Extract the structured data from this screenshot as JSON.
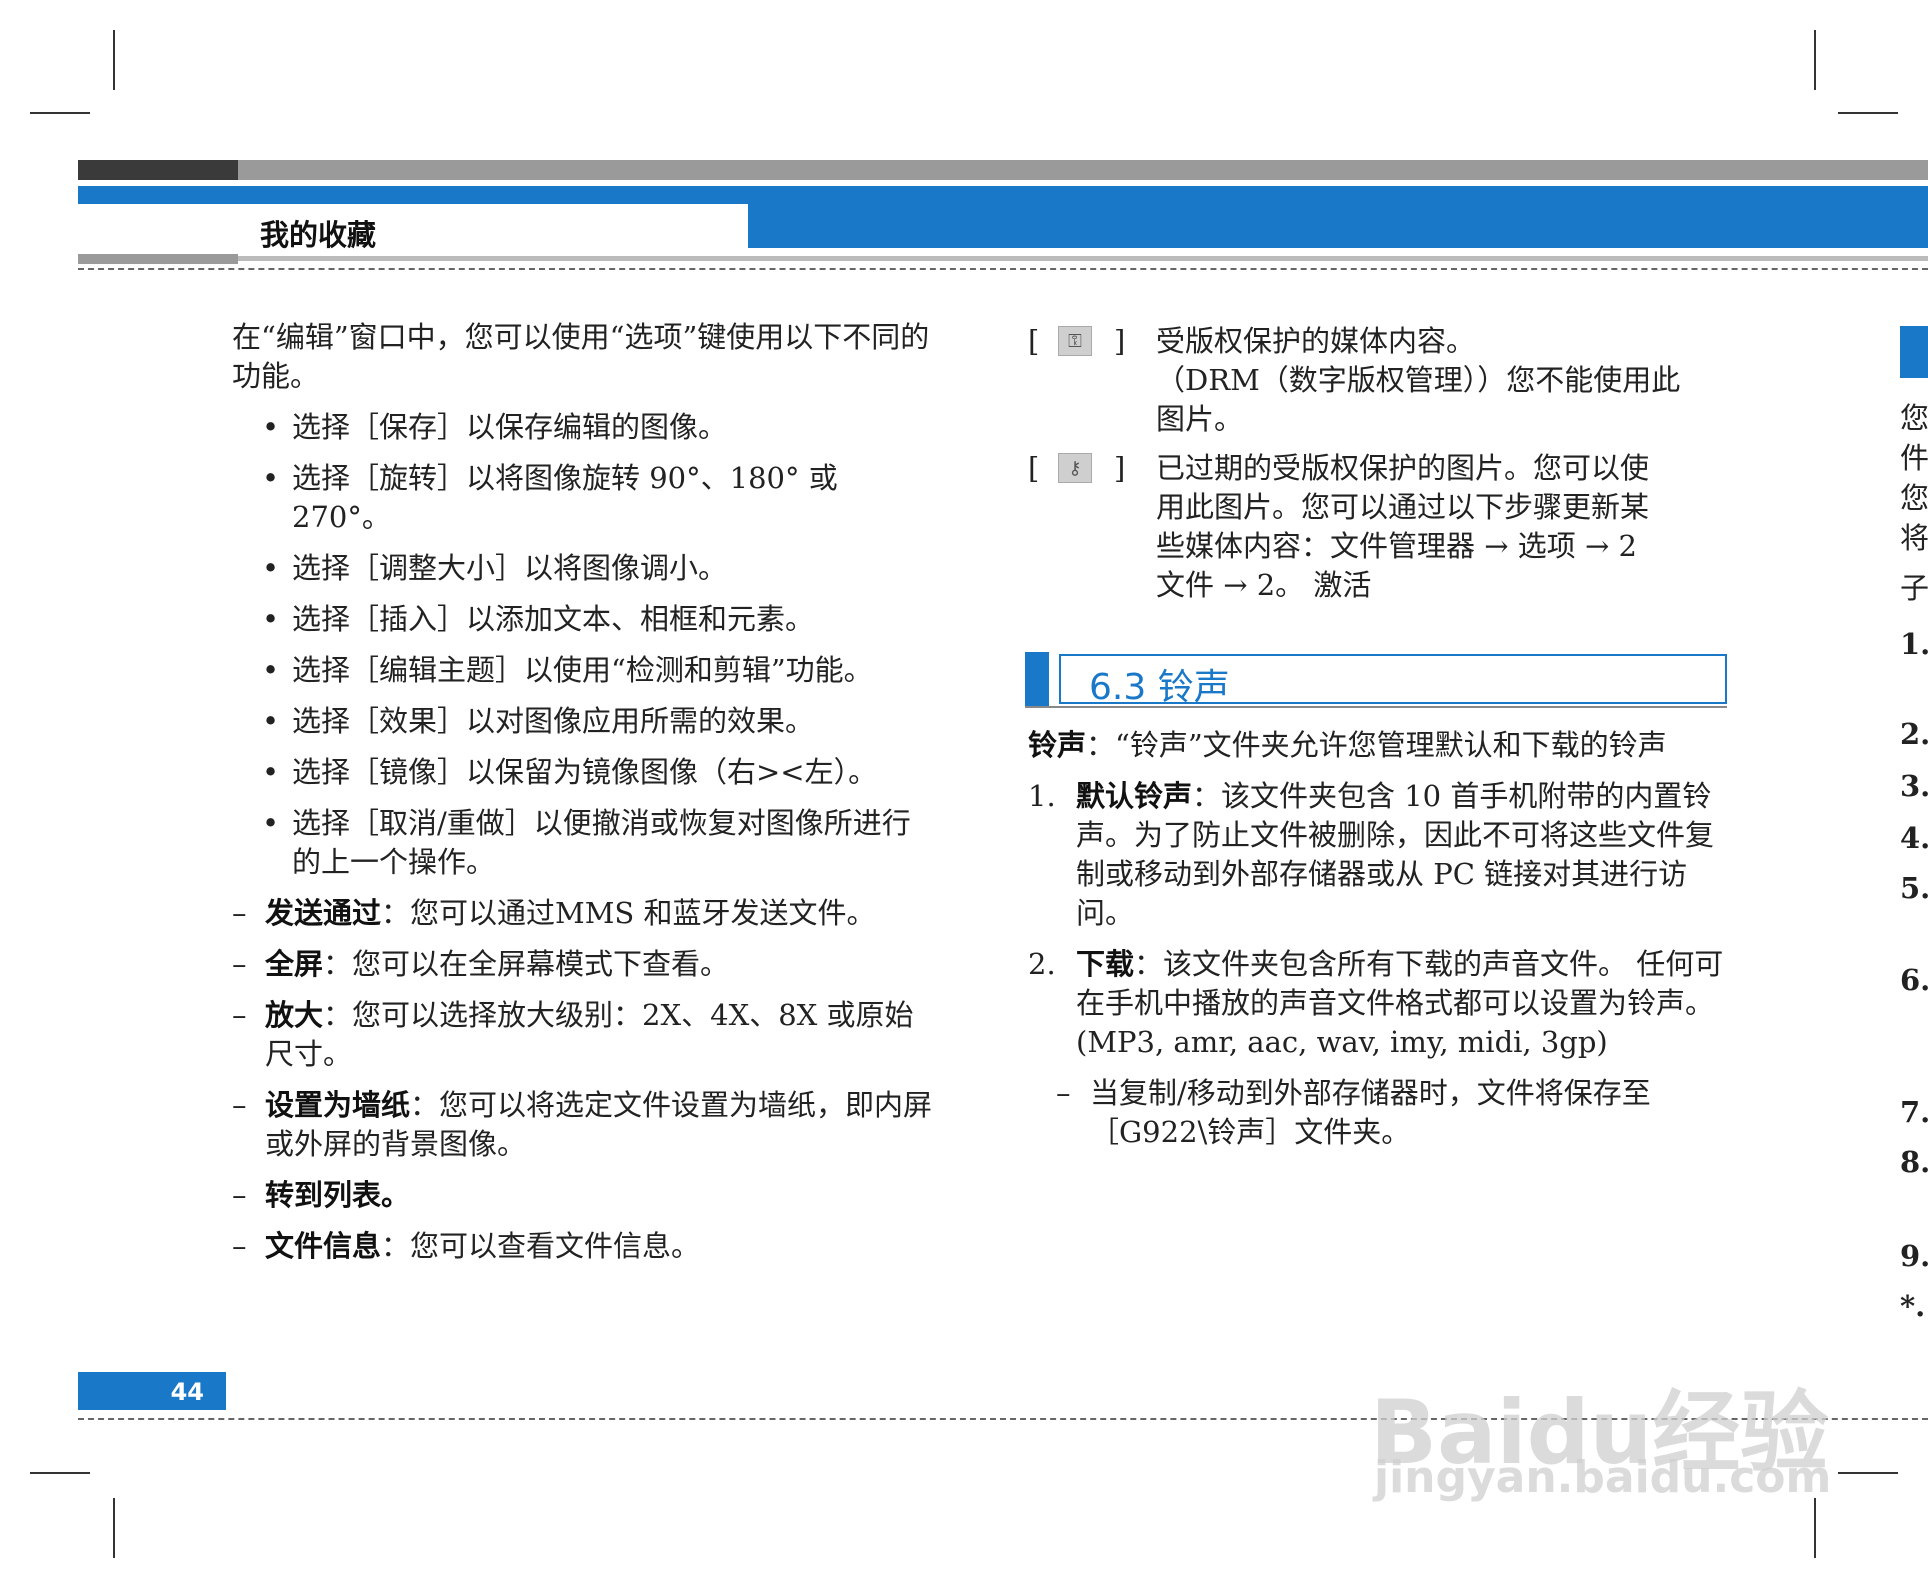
{
  "header": {
    "title": "我的收藏"
  },
  "left": {
    "intro": "在“编辑”窗口中，您可以使用“选项”键使用以下不同的功能。",
    "bullets": [
      "选择［保存］以保存编辑的图像。",
      "选择［旋转］以将图像旋转 90°、180° 或 270°。",
      "选择［调整大小］以将图像调小。",
      "选择［插入］以添加文本、相框和元素。",
      "选择［编辑主题］以使用“检测和剪辑”功能。",
      "选择［效果］以对图像应用所需的效果。",
      "选择［镜像］以保留为镜像图像（右><左）。",
      "选择［取消/重做］以便撤消或恢复对图像所进行的上一个操作。"
    ],
    "dashes": [
      {
        "term": "发送通过",
        "text": "：您可以通过MMS 和蓝牙发送文件。"
      },
      {
        "term": "全屏",
        "text": "：您可以在全屏幕模式下查看。"
      },
      {
        "term": "放大",
        "text": "：您可以选择放大级别：2X、4X、8X 或原始尺寸。"
      },
      {
        "term": "设置为墙纸",
        "text": "：您可以将选定文件设置为墙纸，即内屏或外屏的背景图像。"
      },
      {
        "term": "转到列表。",
        "text": ""
      },
      {
        "term": "文件信息",
        "text": "：您可以查看文件信息。"
      }
    ]
  },
  "right": {
    "icons": [
      {
        "icon": "key-icon",
        "glyph": "⚿",
        "lines": [
          "受版权保护的媒体内容。",
          "（DRM（数字版权管理））您不能使用此",
          "图片。"
        ]
      },
      {
        "icon": "expired-key-icon",
        "glyph": "⚷",
        "lines": [
          "已过期的受版权保护的图片。您可以使",
          "用此图片。您可以通过以下步骤更新某",
          "些媒体内容：文件管理器 → 选项 → 2",
          "文件 → 2。 激活"
        ]
      }
    ],
    "section_title": "6.3 铃声",
    "section_intro_term": "铃声",
    "section_intro": "：“铃声”文件夹允许您管理默认和下载的铃声",
    "items": [
      {
        "num": "1.",
        "term": "默认铃声",
        "text": "：该文件夹包含 10 首手机附带的内置铃声。为了防止文件被删除，因此不可将这些文件复制或移动到外部存储器或从 PC 链接对其进行访问。"
      },
      {
        "num": "2.",
        "term": "下载",
        "text": "：该文件夹包含所有下载的声音文件。 任何可在手机中播放的声音文件格式都可以设置为铃声。(MP3, amr, aac, wav, imy, midi, 3gp)"
      }
    ],
    "subnote": "当复制/移动到外部存储器时，文件将保存至［G922\\铃声］文件夹。"
  },
  "edge": {
    "chars": [
      "您",
      "件",
      "您",
      "将",
      "子"
    ],
    "numbers": [
      "1.",
      "2.",
      "3.",
      "4.",
      "5.",
      "6.",
      "7.",
      "8.",
      "9.",
      "*."
    ]
  },
  "footer": {
    "page_number": "44"
  },
  "watermark": {
    "logo": "Baidu经验",
    "url": "jingyan.baidu.com"
  }
}
